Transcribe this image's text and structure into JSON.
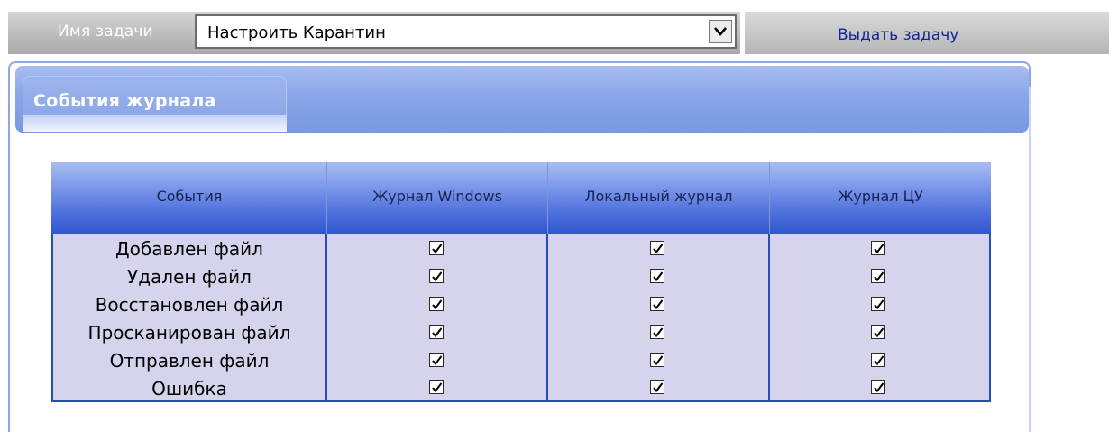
{
  "toolbar": {
    "task_label": "Имя задачи",
    "task_select_value": "Настроить Карантин",
    "issue_button": "Выдать задачу"
  },
  "panel": {
    "tab_title": "События журнала"
  },
  "table": {
    "columns": [
      "События",
      "Журнал Windows",
      "Локальный журнал",
      "Журнал ЦУ"
    ],
    "rows": [
      {
        "event": "Добавлен файл",
        "checks": [
          true,
          true,
          true
        ]
      },
      {
        "event": "Удален файл",
        "checks": [
          true,
          true,
          true
        ]
      },
      {
        "event": "Восстановлен файл",
        "checks": [
          true,
          true,
          true
        ]
      },
      {
        "event": "Просканирован файл",
        "checks": [
          true,
          true,
          true
        ]
      },
      {
        "event": "Отправлен файл",
        "checks": [
          true,
          true,
          true
        ]
      },
      {
        "event": "Ошибка",
        "checks": [
          true,
          true,
          true
        ]
      }
    ]
  },
  "icons": {
    "select_arrow": "chevron-down-icon",
    "checkbox": "checkmark-icon"
  },
  "colors": {
    "header_blue": "#2e55cf",
    "body_lavender": "#d5d4ec",
    "link_blue": "#15249b"
  }
}
